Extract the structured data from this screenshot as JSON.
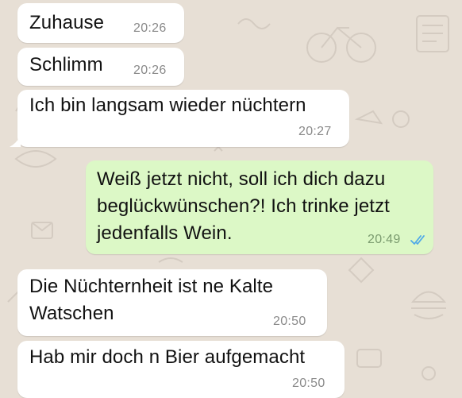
{
  "chat": {
    "messages": [
      {
        "direction": "incoming",
        "text": "Zuhause",
        "time": "20:26"
      },
      {
        "direction": "incoming",
        "text": "Schlimm",
        "time": "20:26"
      },
      {
        "direction": "incoming",
        "text": "Ich bin langsam wieder nüchtern",
        "time": "20:27"
      },
      {
        "direction": "outgoing",
        "text": "Weiß jetzt nicht, soll ich dich dazu\nbeglückwünschen?! Ich trinke jetzt\njedenfalls Wein.",
        "time": "20:49",
        "status": "read",
        "status_icon": "double-check-icon"
      },
      {
        "direction": "incoming",
        "text": "Die Nüchternheit ist ne Kalte\nWatschen",
        "time": "20:50"
      },
      {
        "direction": "incoming",
        "text": "Hab mir doch n Bier aufgemacht",
        "time": "20:50"
      }
    ]
  },
  "colors": {
    "incoming_bubble": "#ffffff",
    "outgoing_bubble": "#dcf8c6",
    "read_ticks": "#4fa9e8",
    "chat_background": "#e7dfd5"
  }
}
